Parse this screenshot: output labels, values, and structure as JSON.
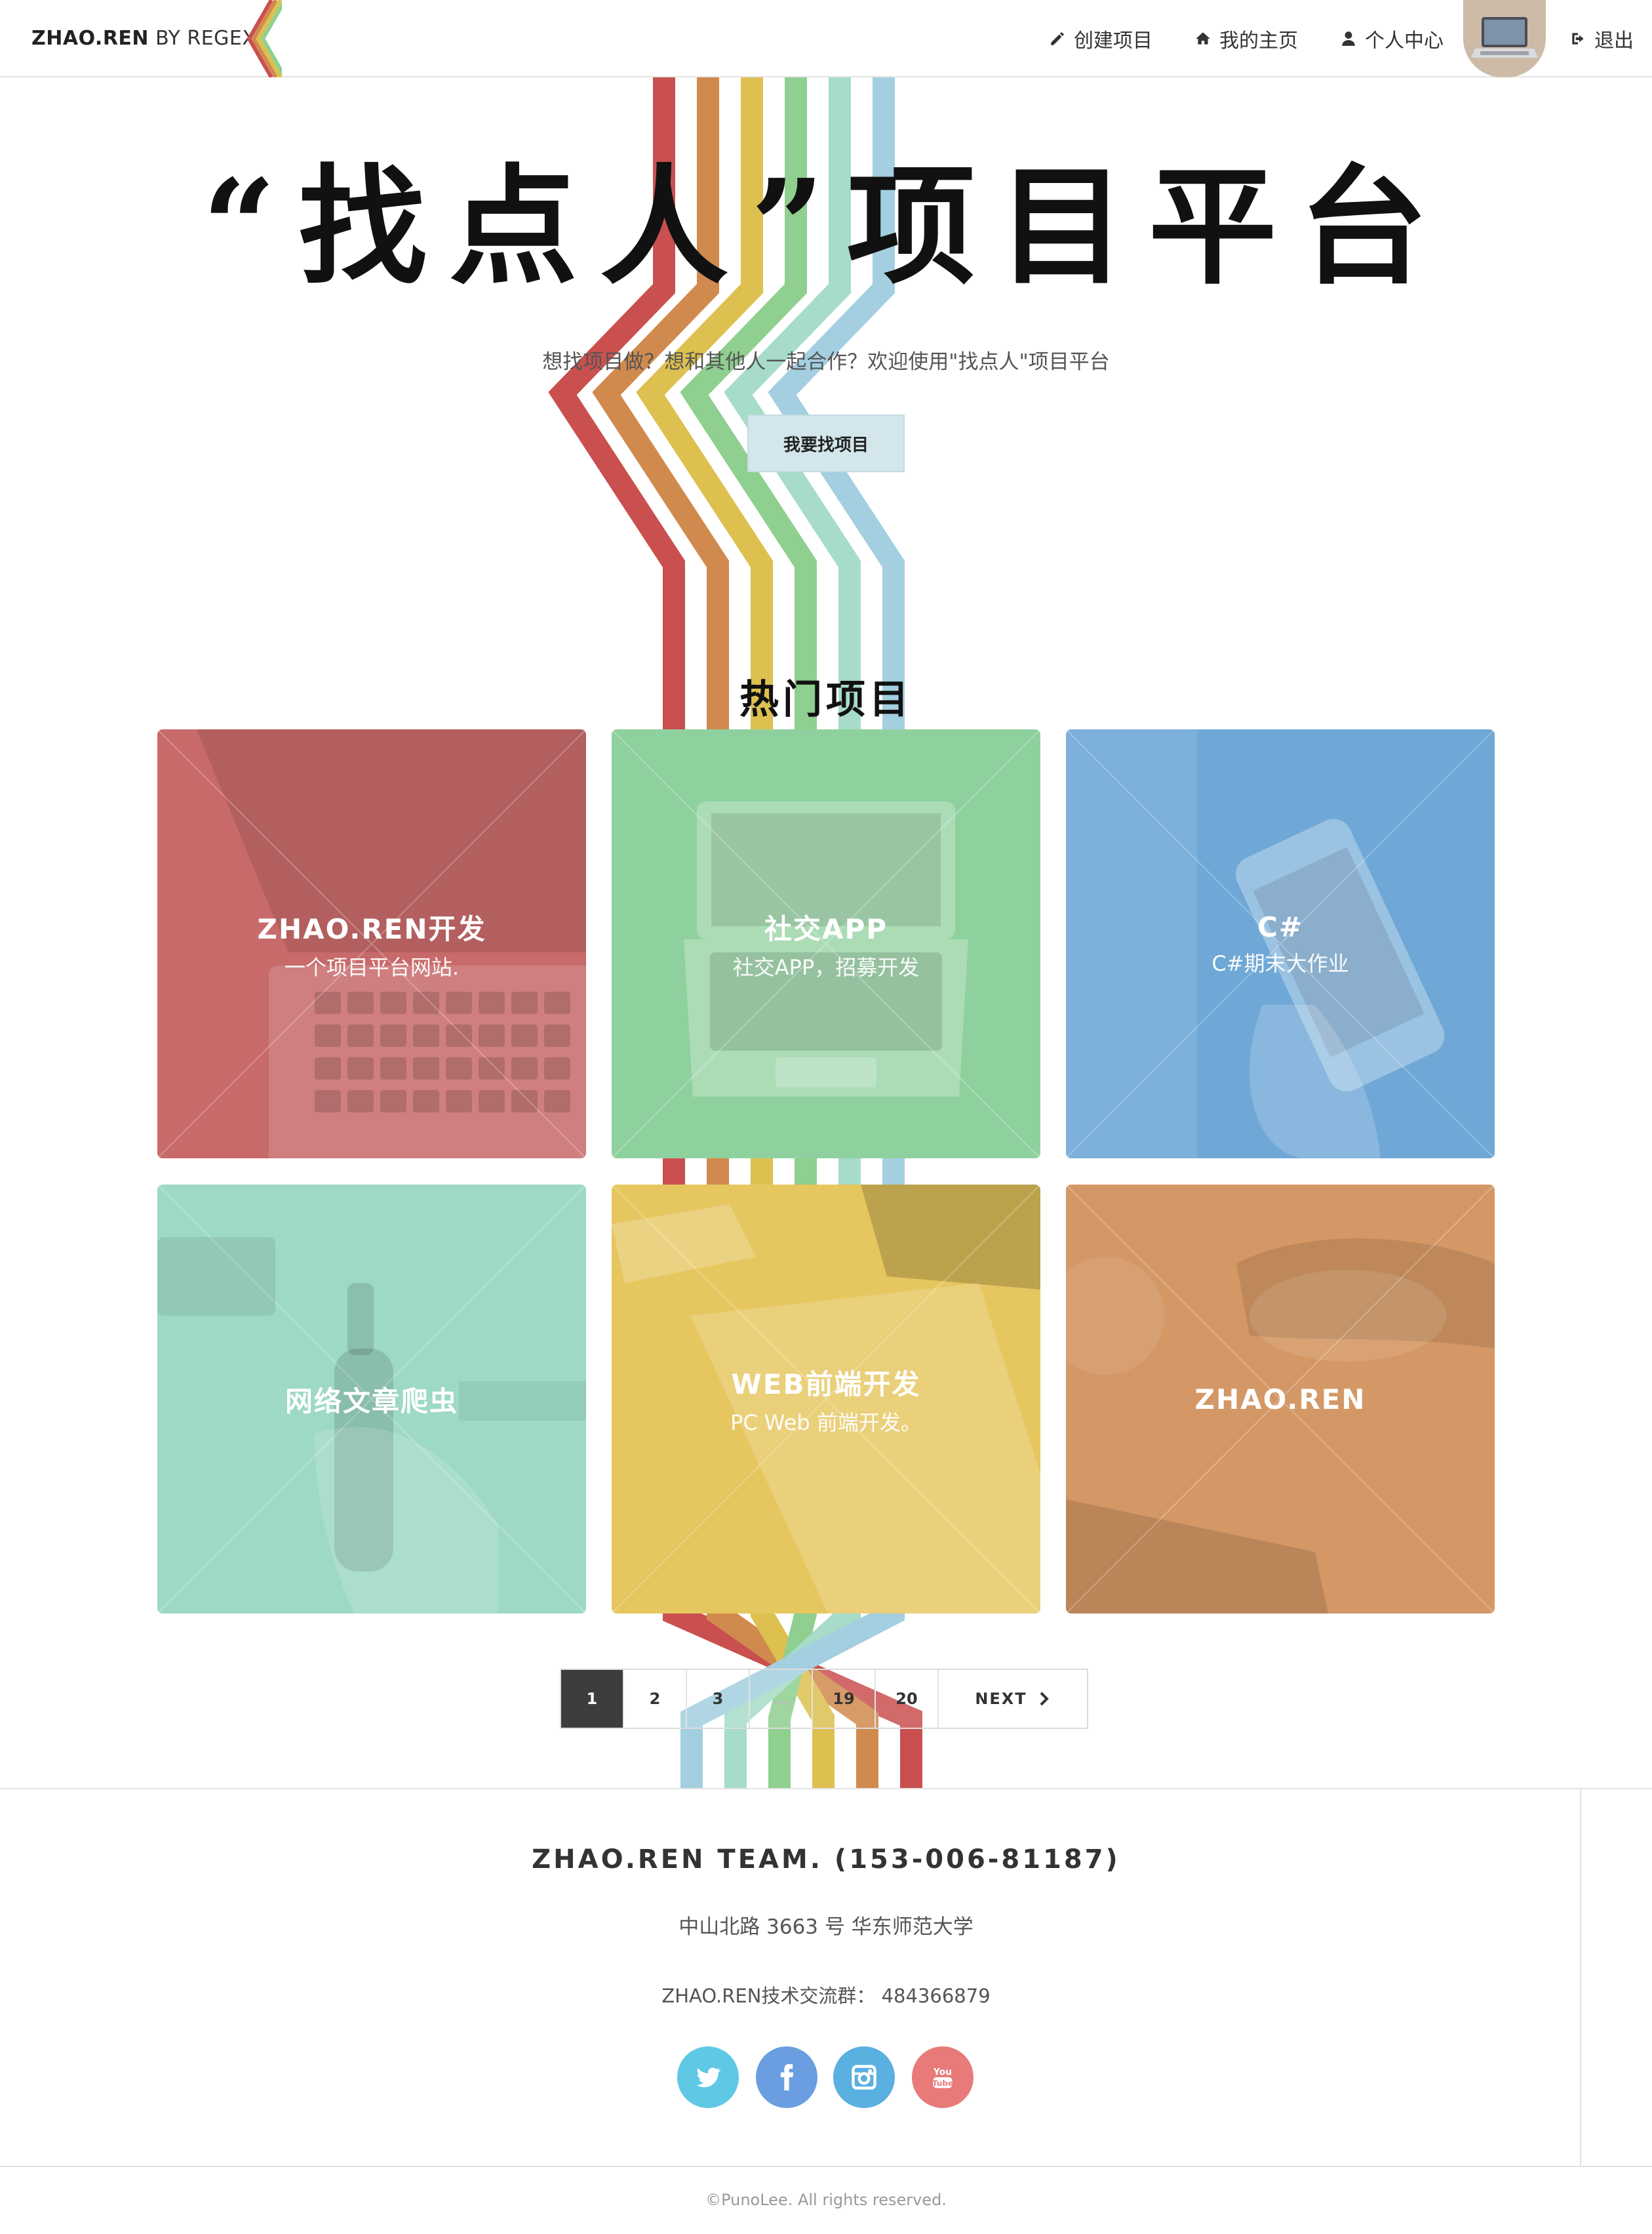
{
  "header": {
    "brand_bold": "ZHAO.REN",
    "brand_rest": " BY REGEX",
    "nav": {
      "create": "创建项目",
      "home": "我的主页",
      "profile": "个人中心",
      "logout": "退出"
    }
  },
  "hero": {
    "title": "“找点人”项目平台",
    "subtitle": "想找项目做？想和其他人一起合作？欢迎使用\"找点人\"项目平台",
    "button": "我要找项目"
  },
  "section_title": "热门项目",
  "cards": [
    {
      "title": "ZHAO.REN开发",
      "desc": "一个项目平台网站.",
      "color": "#c86a6a"
    },
    {
      "title": "社交APP",
      "desc": "社交APP，招募开发",
      "color": "#8fd19e"
    },
    {
      "title": "C#",
      "desc": "C#期末大作业",
      "color": "#6fa8d6"
    },
    {
      "title": "网络文章爬虫",
      "desc": "",
      "color": "#9ed9c6"
    },
    {
      "title": "WEB前端开发",
      "desc": "PC Web 前端开发。",
      "color": "#e6c65f"
    },
    {
      "title": "ZHAO.REN",
      "desc": "",
      "color": "#d49866"
    }
  ],
  "pagination": {
    "pages": [
      "1",
      "2",
      "3",
      "...",
      "19",
      "20"
    ],
    "active": "1",
    "next": "NEXT"
  },
  "footer": {
    "team": "ZHAO.REN TEAM. (153-006-81187)",
    "address": "中山北路 3663 号 华东师范大学",
    "qq": "ZHAO.REN技术交流群：  484366879",
    "copyright": "©PunoLee. All rights reserved.",
    "social": [
      {
        "name": "twitter-icon",
        "color": "#5ec8e5"
      },
      {
        "name": "facebook-icon",
        "color": "#6a9ee0"
      },
      {
        "name": "instagram-icon",
        "color": "#5ab0e0"
      },
      {
        "name": "youtube-icon",
        "color": "#e87a7a"
      }
    ]
  },
  "stripe_colors": [
    "#c9504f",
    "#d18a4e",
    "#ddc04f",
    "#8fcf8f",
    "#a6dcc8",
    "#a3cfe0"
  ]
}
